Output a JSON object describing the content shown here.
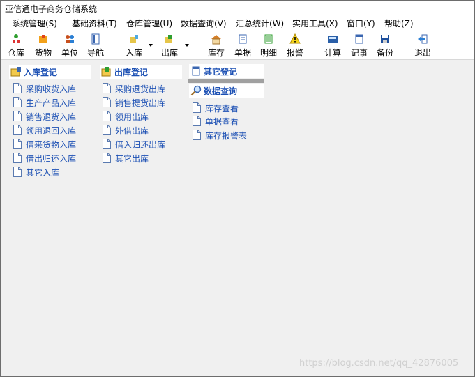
{
  "window": {
    "title": "亚信通电子商务仓储系统"
  },
  "menu": [
    {
      "label": "系统管理(S)"
    },
    {
      "label": "基础资料(T)"
    },
    {
      "label": "仓库管理(U)"
    },
    {
      "label": "数据查询(V)"
    },
    {
      "label": "汇总统计(W)"
    },
    {
      "label": "实用工具(X)"
    },
    {
      "label": "窗口(Y)"
    },
    {
      "label": "帮助(Z)"
    }
  ],
  "toolbar": [
    {
      "label": "仓库",
      "icon": "warehouse-icon"
    },
    {
      "label": "货物",
      "icon": "goods-icon"
    },
    {
      "label": "单位",
      "icon": "units-icon"
    },
    {
      "label": "导航",
      "icon": "navigation-icon"
    },
    {
      "label": "入库",
      "icon": "stock-in-icon"
    },
    {
      "label": "出库",
      "icon": "stock-out-icon"
    },
    {
      "label": "库存",
      "icon": "inventory-icon"
    },
    {
      "label": "单据",
      "icon": "documents-icon"
    },
    {
      "label": "明细",
      "icon": "details-icon"
    },
    {
      "label": "报警",
      "icon": "alarm-icon"
    },
    {
      "label": "计算",
      "icon": "calculator-icon"
    },
    {
      "label": "记事",
      "icon": "notepad-icon"
    },
    {
      "label": "备份",
      "icon": "backup-icon"
    },
    {
      "label": "退出",
      "icon": "exit-icon"
    }
  ],
  "panels": {
    "stock_in": {
      "title": "入库登记",
      "items": [
        "采购收货入库",
        "生产产品入库",
        "销售退货入库",
        "领用退回入库",
        "借来货物入库",
        "借出归还入库",
        "其它入库"
      ]
    },
    "stock_out": {
      "title": "出库登记",
      "items": [
        "采购退货出库",
        "销售提货出库",
        "领用出库",
        "外借出库",
        "借入归还出库",
        "其它出库"
      ]
    },
    "other": {
      "title": "其它登记"
    },
    "query": {
      "title": "数据查询",
      "items": [
        "库存查看",
        "单据查看",
        "库存报警表"
      ]
    }
  },
  "watermark": "https://blog.csdn.net/qq_42876005",
  "colors": {
    "link": "#1c50b4",
    "background": "#f0f0f0",
    "bar": "#ffffff"
  }
}
